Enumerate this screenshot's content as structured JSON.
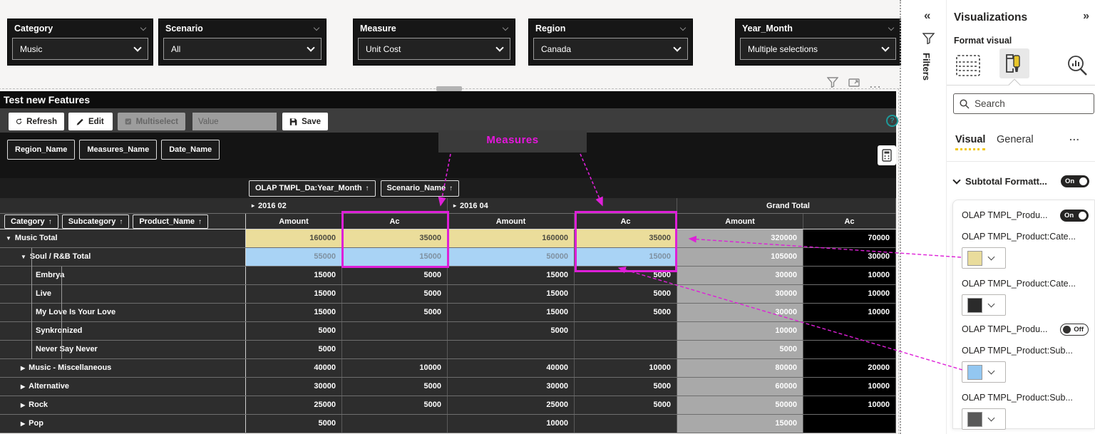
{
  "canvas": {
    "slicers": [
      {
        "label": "Category",
        "value": "Music"
      },
      {
        "label": "Scenario",
        "value": "All"
      },
      {
        "label": "Measure",
        "value": "Unit Cost"
      },
      {
        "label": "Region",
        "value": "Canada"
      },
      {
        "label": "Year_Month",
        "value": "Multiple selections"
      }
    ]
  },
  "visual": {
    "title": "Test new Features",
    "toolbar": {
      "refresh": "Refresh",
      "edit": "Edit",
      "multiselect": "Multiselect",
      "value_placeholder": "Value",
      "save": "Save"
    },
    "field_chips": [
      "Region_Name",
      "Measures_Name",
      "Date_Name"
    ],
    "column_field_chips": [
      "OLAP TMPL_Da:Year_Month",
      "Scenario_Name"
    ],
    "row_field_chips": [
      "Category",
      "Subcategory",
      "Product_Name"
    ],
    "column_groups": [
      {
        "label": "2016 02",
        "expander": "▸"
      },
      {
        "label": "2016 04",
        "expander": "▸"
      },
      {
        "label": "Grand Total",
        "expander": ""
      }
    ],
    "value_headers": [
      "Amount",
      "Ac",
      "Amount",
      "Ac",
      "Amount",
      "Ac"
    ],
    "rows": [
      {
        "label": "Music Total",
        "level": 0,
        "expander": "▼",
        "style": "yellow",
        "values": [
          "160000",
          "35000",
          "160000",
          "35000",
          "320000",
          "70000"
        ]
      },
      {
        "label": "Soul / R&B Total",
        "level": 1,
        "expander": "▼",
        "style": "blue",
        "values": [
          "55000",
          "15000",
          "50000",
          "15000",
          "105000",
          "30000"
        ]
      },
      {
        "label": "Embrya",
        "level": 2,
        "expander": "",
        "style": "normal",
        "values": [
          "15000",
          "5000",
          "15000",
          "5000",
          "30000",
          "10000"
        ]
      },
      {
        "label": "Live",
        "level": 2,
        "expander": "",
        "style": "normal",
        "values": [
          "15000",
          "5000",
          "15000",
          "5000",
          "30000",
          "10000"
        ]
      },
      {
        "label": "My Love Is Your Love",
        "level": 2,
        "expander": "",
        "style": "normal",
        "values": [
          "15000",
          "5000",
          "15000",
          "5000",
          "30000",
          "10000"
        ]
      },
      {
        "label": "Synkronized",
        "level": 2,
        "expander": "",
        "style": "normal",
        "values": [
          "5000",
          "",
          "5000",
          "",
          "10000",
          ""
        ]
      },
      {
        "label": "Never Say Never",
        "level": 2,
        "expander": "",
        "style": "normal",
        "values": [
          "5000",
          "",
          "",
          "",
          "5000",
          ""
        ]
      },
      {
        "label": "Music - Miscellaneous",
        "level": 1,
        "expander": "▶",
        "style": "normal",
        "values": [
          "40000",
          "10000",
          "40000",
          "10000",
          "80000",
          "20000"
        ]
      },
      {
        "label": "Alternative",
        "level": 1,
        "expander": "▶",
        "style": "normal",
        "values": [
          "30000",
          "5000",
          "30000",
          "5000",
          "60000",
          "10000"
        ]
      },
      {
        "label": "Rock",
        "level": 1,
        "expander": "▶",
        "style": "normal",
        "values": [
          "25000",
          "5000",
          "25000",
          "5000",
          "50000",
          "10000"
        ]
      },
      {
        "label": "Pop",
        "level": 1,
        "expander": "▶",
        "style": "normal",
        "values": [
          "5000",
          "",
          "10000",
          "",
          "15000",
          ""
        ]
      }
    ]
  },
  "annotation": {
    "measures_label": "Measures"
  },
  "panel": {
    "filters_collapsed_label": "Filters",
    "visualizations_title": "Visualizations",
    "format_visual_label": "Format visual",
    "search_placeholder": "Search",
    "tabs": [
      "Visual",
      "General"
    ],
    "section": {
      "label": "Subtotal Formatt...",
      "state": "On"
    },
    "items": [
      {
        "type": "toggle",
        "label": "OLAP TMPL_Produ...",
        "state": "On"
      },
      {
        "type": "color",
        "label": "OLAP TMPL_Product:Cate...",
        "color": "#e9dc9c"
      },
      {
        "type": "color",
        "label": "OLAP TMPL_Product:Cate...",
        "color": "#2b2b2b"
      },
      {
        "type": "toggle",
        "label": "OLAP TMPL_Produ...",
        "state": "Off"
      },
      {
        "type": "color",
        "label": "OLAP TMPL_Product:Sub...",
        "color": "#93c7f1"
      },
      {
        "type": "color",
        "label": "OLAP TMPL_Product:Sub...",
        "color": "#595959"
      }
    ]
  },
  "icons": {
    "collapse_left": "«",
    "expand_right": "»",
    "ellipsis": "...",
    "more_options": "...",
    "sort_ascending": "↑",
    "help": "?"
  },
  "colors": {
    "accent_magenta": "#de1fd8",
    "row_highlight_yellow": "#ebdd9b",
    "row_highlight_yellow_text": "#4c4b41",
    "row_highlight_blue": "#a9d3f5",
    "row_highlight_blue_text": "#7f91a1",
    "grand_total_gray": "#a9a9a9",
    "grand_total_black": "#000000",
    "tab_underline_yellow": "#f2c80f",
    "help_teal": "#1d9a9a"
  }
}
